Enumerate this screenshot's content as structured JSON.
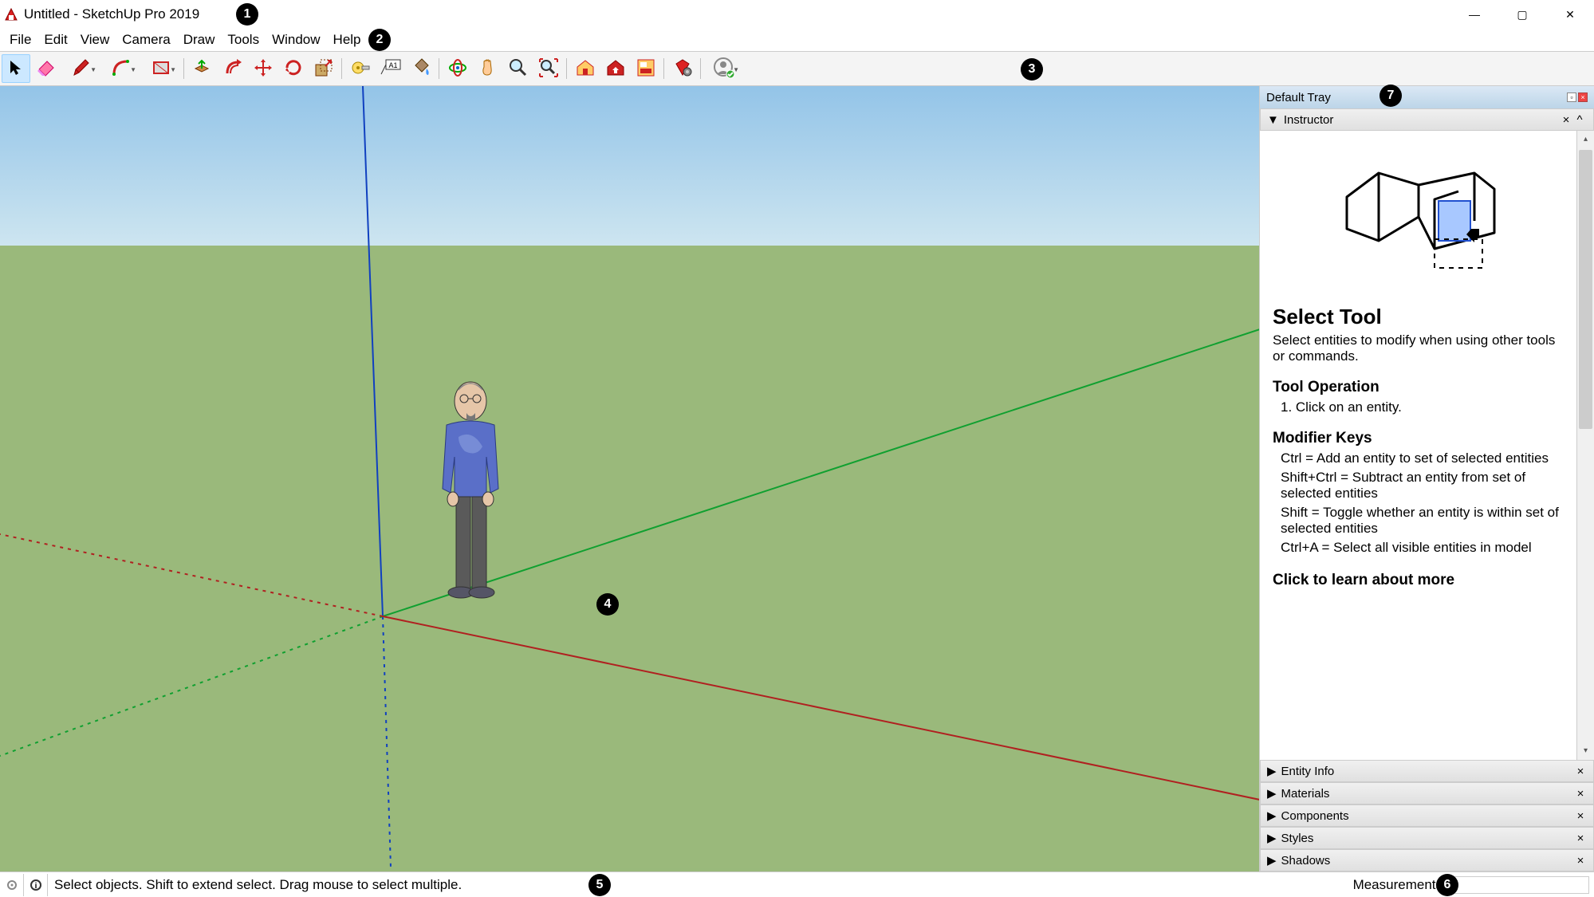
{
  "title": "Untitled - SketchUp Pro 2019",
  "window_controls": {
    "min": "—",
    "max": "▢",
    "close": "✕"
  },
  "menu": [
    "File",
    "Edit",
    "View",
    "Camera",
    "Draw",
    "Tools",
    "Window",
    "Help"
  ],
  "badges": [
    "1",
    "2",
    "3",
    "4",
    "5",
    "6",
    "7"
  ],
  "toolbar": [
    {
      "name": "select-tool",
      "selected": true,
      "icon": "cursor"
    },
    {
      "name": "eraser-tool",
      "icon": "eraser"
    },
    {
      "name": "line-tool",
      "dropdown": true,
      "icon": "pencil"
    },
    {
      "name": "arc-tool",
      "dropdown": true,
      "icon": "arc"
    },
    {
      "name": "shape-tool",
      "dropdown": true,
      "icon": "rect"
    },
    {
      "sep": true
    },
    {
      "name": "pushpull-tool",
      "icon": "pushpull"
    },
    {
      "name": "offset-tool",
      "icon": "offset"
    },
    {
      "name": "move-tool",
      "icon": "move"
    },
    {
      "name": "rotate-tool",
      "icon": "rotate"
    },
    {
      "name": "scale-tool",
      "icon": "scale"
    },
    {
      "sep": true
    },
    {
      "name": "tape-measure-tool",
      "icon": "tape"
    },
    {
      "name": "text-tool",
      "icon": "text"
    },
    {
      "name": "paint-bucket-tool",
      "icon": "bucket"
    },
    {
      "sep": true
    },
    {
      "name": "orbit-tool",
      "icon": "orbit"
    },
    {
      "name": "pan-tool",
      "icon": "pan"
    },
    {
      "name": "zoom-tool",
      "icon": "zoom"
    },
    {
      "name": "zoom-extents-tool",
      "icon": "zoomext"
    },
    {
      "sep": true
    },
    {
      "name": "3d-warehouse-button",
      "icon": "wh"
    },
    {
      "name": "extension-warehouse-button",
      "icon": "extwh"
    },
    {
      "name": "layout-button",
      "icon": "layout"
    },
    {
      "sep": true
    },
    {
      "name": "extension-manager-button",
      "icon": "gem"
    },
    {
      "sep": true
    },
    {
      "name": "user-button",
      "dropdown": true,
      "icon": "user"
    }
  ],
  "tray": {
    "title": "Default Tray",
    "instructor": {
      "panel_title": "Instructor",
      "tool_title": "Select Tool",
      "tool_desc": "Select entities to modify when using other tools or commands.",
      "op_head": "Tool Operation",
      "op_body": "1. Click on an entity.",
      "mod_head": "Modifier Keys",
      "mod1": "Ctrl = Add an entity to set of selected entities",
      "mod2": "Shift+Ctrl = Subtract an entity from set of selected entities",
      "mod3": "Shift = Toggle whether an entity is within set of selected entities",
      "mod4": "Ctrl+A = Select all visible entities in model",
      "learn": "Click to learn about more"
    },
    "panels": [
      "Entity Info",
      "Materials",
      "Components",
      "Styles",
      "Shadows"
    ]
  },
  "status": "Select objects. Shift to extend select. Drag mouse to select multiple.",
  "measurements_label": "Measurements",
  "measurements_value": ""
}
